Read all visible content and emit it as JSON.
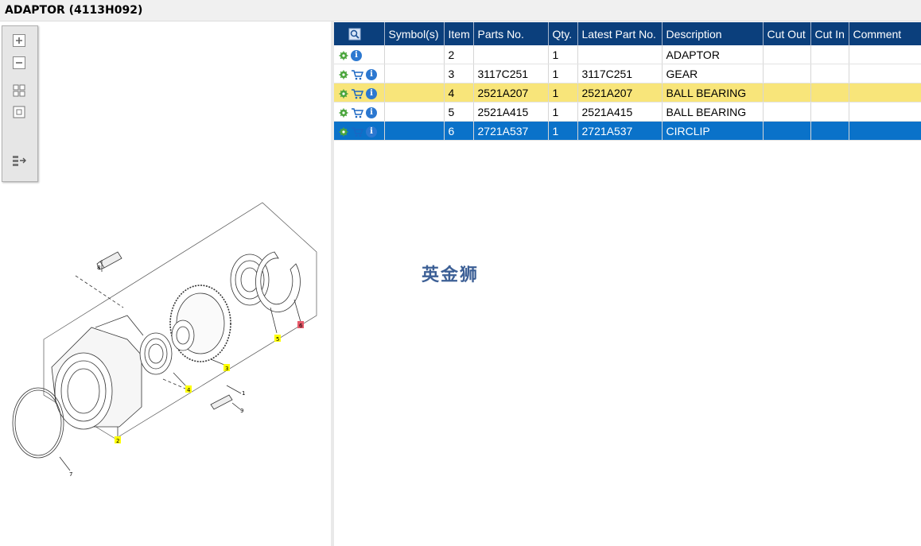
{
  "window": {
    "title": "ADAPTOR (4113H092)"
  },
  "toolbar": {
    "buttons": [
      {
        "name": "zoom-in",
        "icon": "plus-icon"
      },
      {
        "name": "zoom-out",
        "icon": "minus-icon"
      },
      {
        "name": "fit",
        "icon": "grid-icon"
      },
      {
        "name": "actual-size",
        "icon": "square-icon"
      },
      {
        "name": "layout",
        "icon": "split-arrow-icon"
      }
    ]
  },
  "diagram": {
    "callouts": [
      "8",
      "5",
      "6",
      "3",
      "4",
      "1",
      "9",
      "2",
      "7"
    ]
  },
  "watermark": "英金狮",
  "table": {
    "headers": [
      "Symbol(s)",
      "Item",
      "Parts No.",
      "Qty.",
      "Latest Part No.",
      "Description",
      "Cut Out",
      "Cut In",
      "Comment"
    ],
    "rows": [
      {
        "cart": false,
        "item": "2",
        "parts_no": "",
        "qty": "1",
        "latest": "",
        "description": "ADAPTOR",
        "cut_out": "",
        "cut_in": "",
        "comment": "",
        "state": "normal"
      },
      {
        "cart": true,
        "item": "3",
        "parts_no": "3117C251",
        "qty": "1",
        "latest": "3117C251",
        "description": "GEAR",
        "cut_out": "",
        "cut_in": "",
        "comment": "",
        "state": "normal"
      },
      {
        "cart": true,
        "item": "4",
        "parts_no": "2521A207",
        "qty": "1",
        "latest": "2521A207",
        "description": "BALL BEARING",
        "cut_out": "",
        "cut_in": "",
        "comment": "",
        "state": "highlight"
      },
      {
        "cart": true,
        "item": "5",
        "parts_no": "2521A415",
        "qty": "1",
        "latest": "2521A415",
        "description": "BALL BEARING",
        "cut_out": "",
        "cut_in": "",
        "comment": "",
        "state": "normal"
      },
      {
        "cart": true,
        "item": "6",
        "parts_no": "2721A537",
        "qty": "1",
        "latest": "2721A537",
        "description": "CIRCLIP",
        "cut_out": "",
        "cut_in": "",
        "comment": "",
        "state": "selected"
      }
    ],
    "info_glyph": "i"
  },
  "colors": {
    "header": "#0b3f7c",
    "highlight": "#f8e57a",
    "selected": "#0a72c9",
    "callout": "#ffff00",
    "callout_alt": "#e85a6a"
  }
}
